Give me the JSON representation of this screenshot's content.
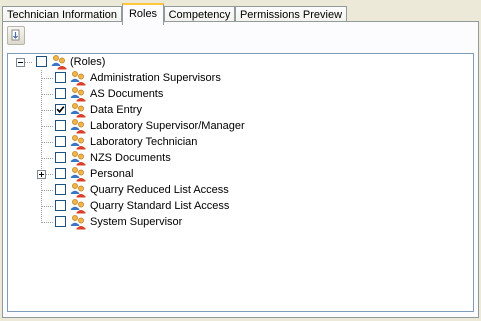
{
  "tabs": [
    {
      "label": "Technician Information",
      "active": false
    },
    {
      "label": "Roles",
      "active": true
    },
    {
      "label": "Competency",
      "active": false
    },
    {
      "label": "Permissions Preview",
      "active": false
    }
  ],
  "toolbar": {
    "button_icon": "filter-toggle-icon"
  },
  "tree": {
    "root": {
      "label": "(Roles)",
      "expanded": true,
      "checked": false,
      "icon": "users-group-icon"
    },
    "items": [
      {
        "label": "Administration Supervisors",
        "checked": false,
        "expandable": false
      },
      {
        "label": "AS Documents",
        "checked": false,
        "expandable": false
      },
      {
        "label": "Data Entry",
        "checked": true,
        "expandable": false
      },
      {
        "label": "Laboratory Supervisor/Manager",
        "checked": false,
        "expandable": false
      },
      {
        "label": "Laboratory Technician",
        "checked": false,
        "expandable": false
      },
      {
        "label": "NZS Documents",
        "checked": false,
        "expandable": false
      },
      {
        "label": "Personal",
        "checked": false,
        "expandable": true
      },
      {
        "label": "Quarry Reduced List Access",
        "checked": false,
        "expandable": false
      },
      {
        "label": "Quarry Standard List Access",
        "checked": false,
        "expandable": false
      },
      {
        "label": "System Supervisor",
        "checked": false,
        "expandable": false
      }
    ]
  },
  "colors": {
    "selection_tab_accent": "#ffc83c",
    "window_bg": "#ece9d8",
    "tree_border": "#7f9db9"
  }
}
